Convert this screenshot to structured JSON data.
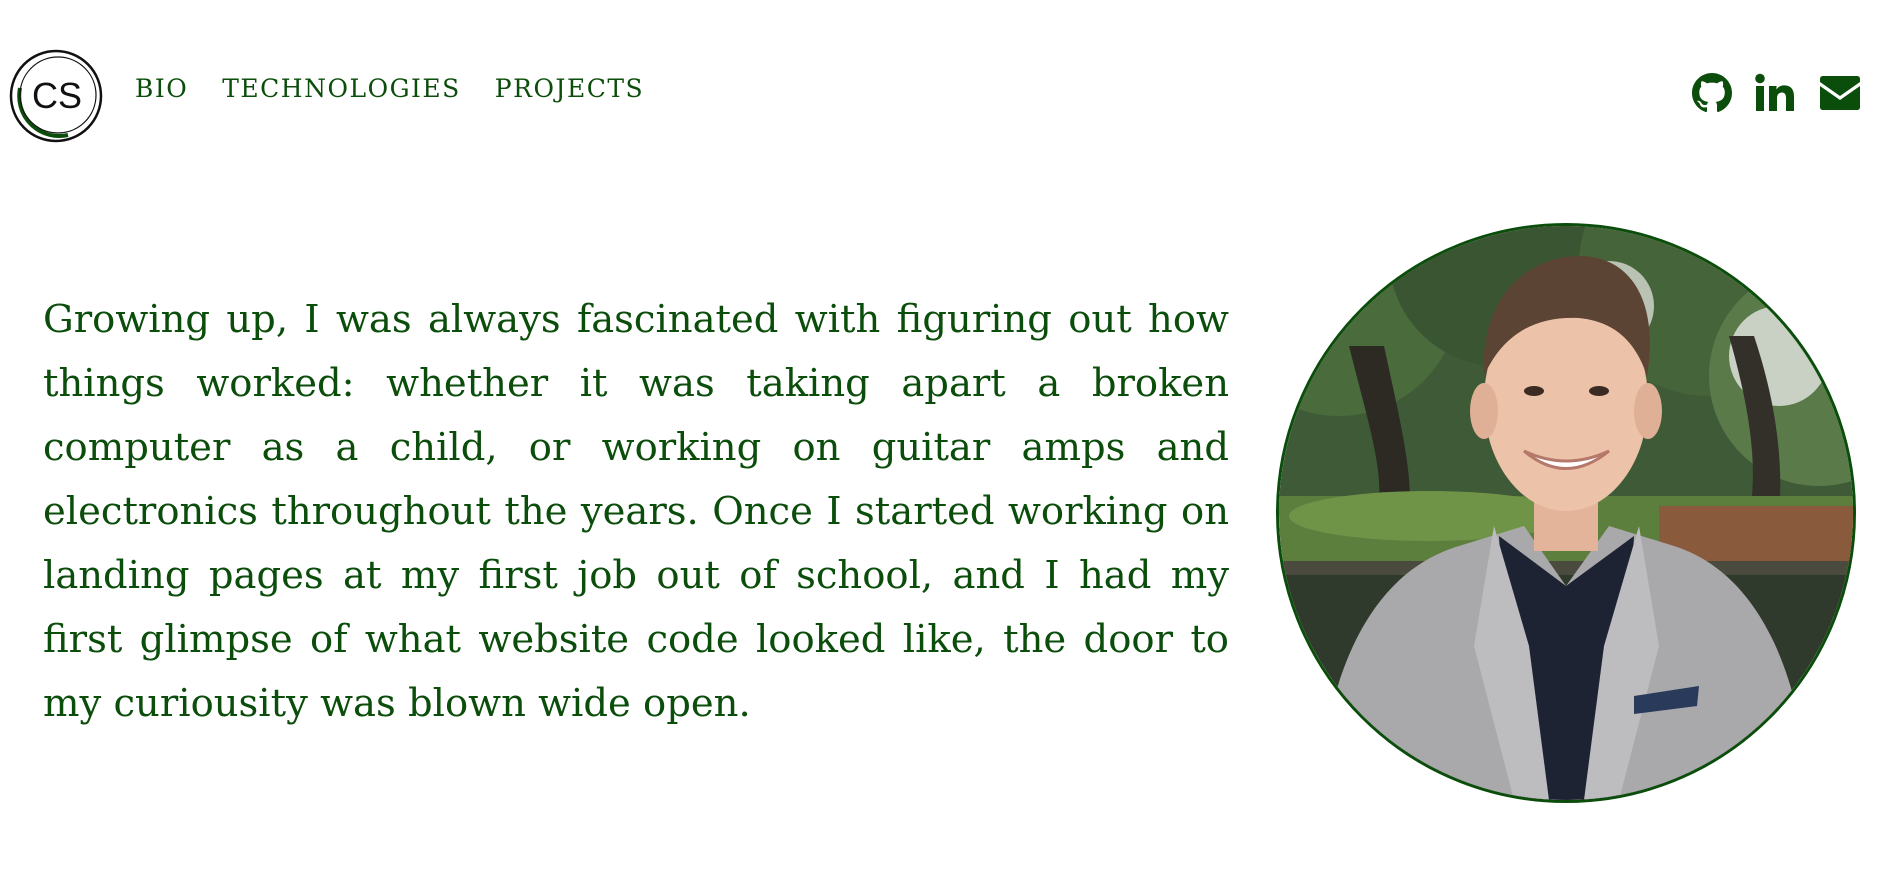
{
  "header": {
    "logo_text": "CS",
    "logo_icon": "circle-monogram-logo",
    "nav": [
      {
        "label": "BIO"
      },
      {
        "label": "TECHNOLOGIES"
      },
      {
        "label": "PROJECTS"
      }
    ],
    "social": [
      {
        "icon": "github-icon"
      },
      {
        "icon": "linkedin-icon"
      },
      {
        "icon": "mail-icon"
      }
    ]
  },
  "main": {
    "bio_text": "Growing up, I was always fascinated with figuring out how things worked: whether it was taking apart a broken computer as a child, or working on guitar amps and electronics throughout the years. Once I started working on landing pages at my first job out of school, and I had my first glimpse of what website code looked like, the door to my curiousity was blown wide open.",
    "portrait_icon": "profile-photo"
  },
  "colors": {
    "accent": "#0b4d0b",
    "background": "#ffffff"
  }
}
